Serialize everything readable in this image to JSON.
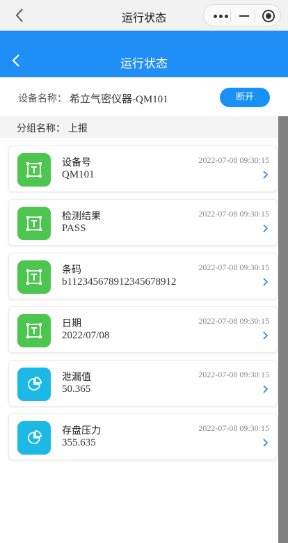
{
  "system_bar": {
    "title": "运行状态"
  },
  "header": {
    "title": "运行状态"
  },
  "device": {
    "label": "设备名称：",
    "name": "希立气密仪器-QM101",
    "disconnect_label": "断开"
  },
  "group": {
    "label": "分组名称：",
    "value": "上报"
  },
  "colors": {
    "primary": "#1f8ff7",
    "green_icon": "#4cc64f",
    "cyan_icon": "#1cb8e6"
  },
  "items": [
    {
      "name": "设备号",
      "value": "QM101",
      "time": "2022-07-08 09:30:15",
      "icon": "text-frame-icon"
    },
    {
      "name": "检测结果",
      "value": "PASS",
      "time": "2022-07-08 09:30:15",
      "icon": "text-frame-icon"
    },
    {
      "name": "条码",
      "value": "b112345678912345678912",
      "time": "2022-07-08 09:30:15",
      "icon": "text-frame-icon"
    },
    {
      "name": "日期",
      "value": "2022/07/08",
      "time": "2022-07-08 09:30:15",
      "icon": "text-frame-icon"
    },
    {
      "name": "泄漏值",
      "value": "50.365",
      "time": "2022-07-08 09:30:15",
      "icon": "pie-chart-icon"
    },
    {
      "name": "存盘压力",
      "value": "355.635",
      "time": "2022-07-08 09:30:15",
      "icon": "pie-chart-icon"
    }
  ]
}
